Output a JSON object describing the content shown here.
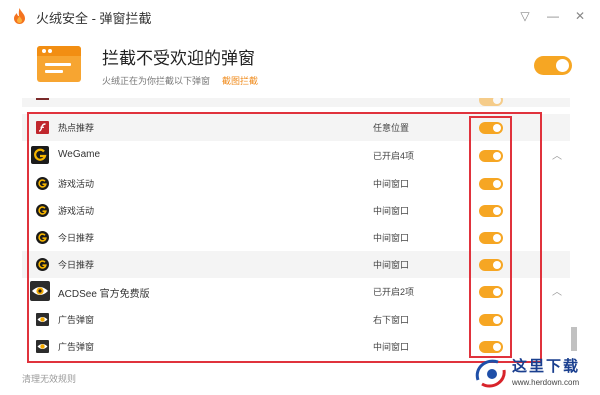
{
  "app": {
    "title": "火绒安全 - 弹窗拦截"
  },
  "window_controls": [
    {
      "name": "menu-icon",
      "glyph": "▽"
    },
    {
      "name": "minimize-icon",
      "glyph": "—"
    },
    {
      "name": "close-icon",
      "glyph": "✕"
    }
  ],
  "header": {
    "title": "拦截不受欢迎的弹窗",
    "description": "火绒正在为你拦截以下弹窗",
    "link": "截图拦截",
    "enabled": true
  },
  "rows": [
    {
      "kind": "child",
      "icon": "flash-icon",
      "name": "热点推荐",
      "position": "任意位置",
      "enabled": true,
      "alt": true
    },
    {
      "kind": "group",
      "icon": "wegame-icon",
      "name": "WeGame",
      "position": "已开启4项",
      "enabled": true,
      "expanded": true,
      "alt": false
    },
    {
      "kind": "child",
      "icon": "wegame-small-icon",
      "name": "游戏活动",
      "position": "中间窗口",
      "enabled": true,
      "alt": false
    },
    {
      "kind": "child",
      "icon": "wegame-small-icon",
      "name": "游戏活动",
      "position": "中间窗口",
      "enabled": true,
      "alt": false
    },
    {
      "kind": "child",
      "icon": "wegame-small-icon",
      "name": "今日推荐",
      "position": "中间窗口",
      "enabled": true,
      "alt": false
    },
    {
      "kind": "child",
      "icon": "wegame-small-icon",
      "name": "今日推荐",
      "position": "中间窗口",
      "enabled": true,
      "alt": true
    },
    {
      "kind": "group",
      "icon": "acdsee-icon",
      "name": "ACDSee 官方免费版",
      "position": "已开启2项",
      "enabled": true,
      "expanded": true,
      "alt": false
    },
    {
      "kind": "child",
      "icon": "acdsee-small-icon",
      "name": "广告弹窗",
      "position": "右下窗口",
      "enabled": true,
      "alt": false
    },
    {
      "kind": "child",
      "icon": "acdsee-small-icon",
      "name": "广告弹窗",
      "position": "中间窗口",
      "enabled": true,
      "alt": false
    }
  ],
  "footer": {
    "text": "清理无效规则"
  },
  "watermark": {
    "text": "这里下载",
    "url": "www.herdown.com"
  },
  "colors": {
    "accent": "#f6a623",
    "annotation": "#e0323c"
  }
}
